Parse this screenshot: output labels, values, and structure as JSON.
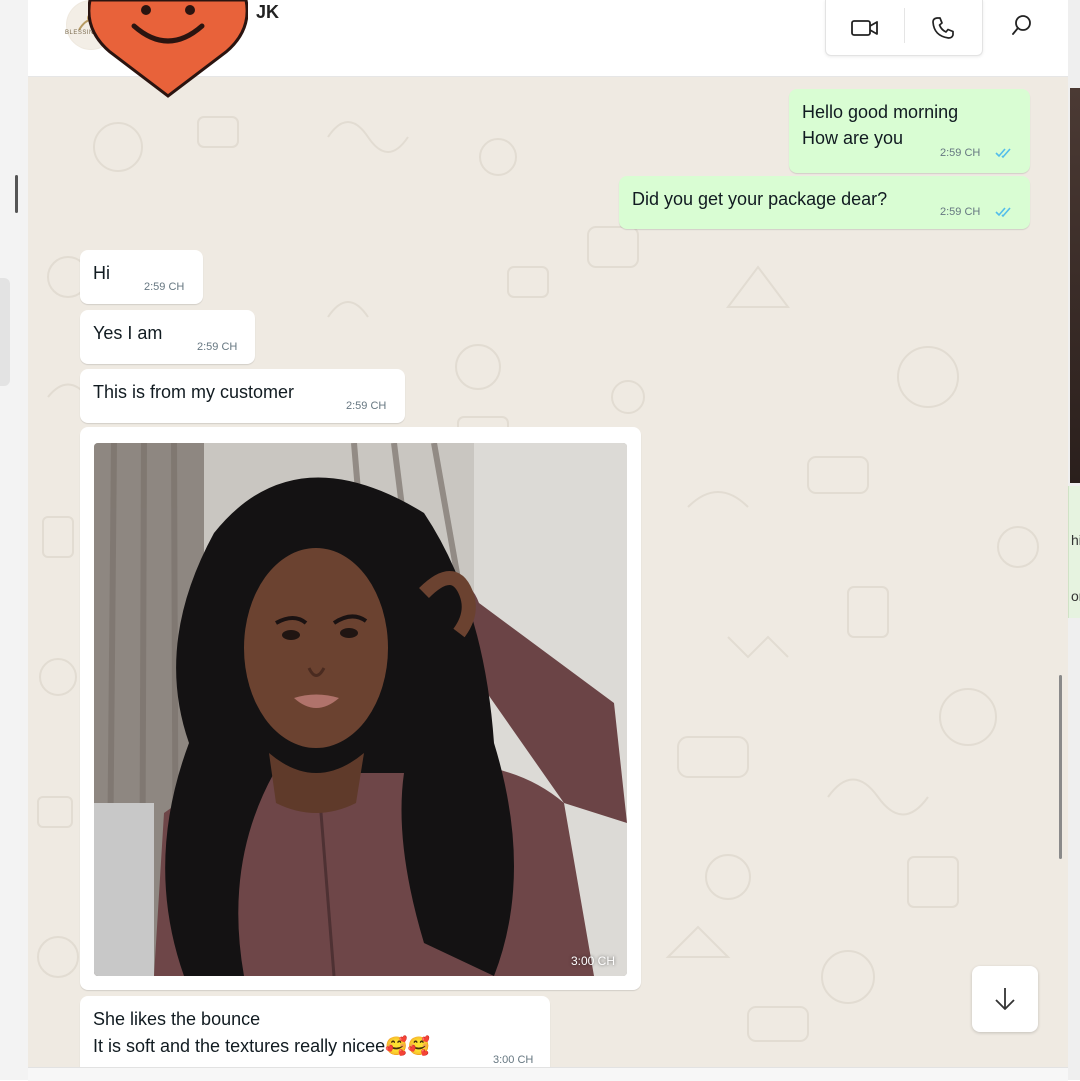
{
  "window": {
    "right_clip_text_1": "hi",
    "right_clip_text_2": "or"
  },
  "header": {
    "avatar_text": "BLESSING",
    "contact_name": "JK",
    "icons": [
      "video-call-icon",
      "voice-call-icon",
      "search-icon"
    ]
  },
  "messages": [
    {
      "dir": "out",
      "lines": [
        "Hello good morning",
        "How are you"
      ],
      "time": "2:59 CH",
      "read": true
    },
    {
      "dir": "out",
      "lines": [
        "Did you get your package dear?"
      ],
      "time": "2:59 CH",
      "read": true
    },
    {
      "dir": "in",
      "lines": [
        "Hi"
      ],
      "time": "2:59 CH"
    },
    {
      "dir": "in",
      "lines": [
        "Yes I am"
      ],
      "time": "2:59 CH"
    },
    {
      "dir": "in",
      "lines": [
        "This is from my customer"
      ],
      "time": "2:59 CH"
    },
    {
      "dir": "in",
      "type": "image",
      "time": "3:00 CH",
      "image_desc_icon": "photo-icon"
    },
    {
      "dir": "in",
      "lines": [
        "She likes the bounce",
        "It is soft and the textures really nicee🥰🥰"
      ],
      "time": "3:00 CH"
    }
  ],
  "overlay": {
    "sticker": "smiley-heart-icon"
  },
  "colors": {
    "outgoing_bubble": "#d9fdd3",
    "incoming_bubble": "#ffffff",
    "chat_bg": "#efeae2",
    "read_ticks": "#53bdeb",
    "sticker": "#e8623a"
  }
}
